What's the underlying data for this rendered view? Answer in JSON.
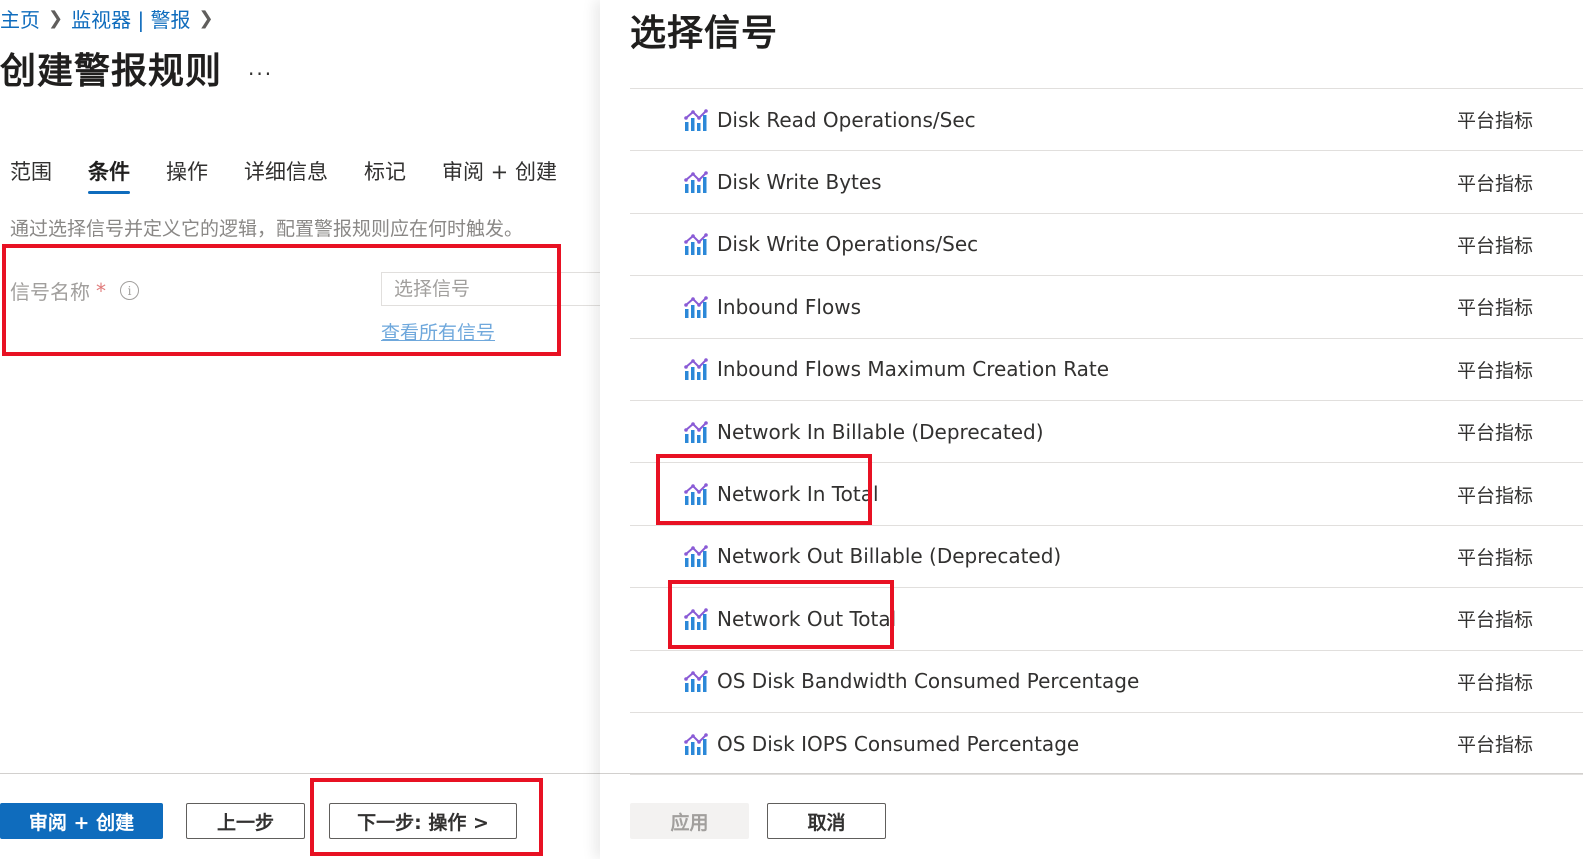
{
  "breadcrumb": {
    "home": "主页",
    "monitor_alerts": "监视器 | 警报"
  },
  "page": {
    "title": "创建警报规则",
    "more": "..."
  },
  "tabs": [
    {
      "label": "范围",
      "active": false
    },
    {
      "label": "条件",
      "active": true
    },
    {
      "label": "操作",
      "active": false
    },
    {
      "label": "详细信息",
      "active": false
    },
    {
      "label": "标记",
      "active": false
    },
    {
      "label": "审阅 + 创建",
      "active": false
    }
  ],
  "condition": {
    "description": "通过选择信号并定义它的逻辑，配置警报规则应在何时触发。",
    "signal_label": "信号名称",
    "required_mark": "*",
    "info": "i",
    "signal_placeholder": "选择信号",
    "view_all_link": "查看所有信号"
  },
  "footer": {
    "review_create": "审阅 + 创建",
    "previous": "上一步",
    "next": "下一步: 操作 >"
  },
  "panel": {
    "title": "选择信号",
    "signals": [
      {
        "name": "Disk Read Operations/Sec",
        "type": "平台指标"
      },
      {
        "name": "Disk Write Bytes",
        "type": "平台指标"
      },
      {
        "name": "Disk Write Operations/Sec",
        "type": "平台指标"
      },
      {
        "name": "Inbound Flows",
        "type": "平台指标"
      },
      {
        "name": "Inbound Flows Maximum Creation Rate",
        "type": "平台指标"
      },
      {
        "name": "Network In Billable (Deprecated)",
        "type": "平台指标"
      },
      {
        "name": "Network In Total",
        "type": "平台指标"
      },
      {
        "name": "Network Out Billable (Deprecated)",
        "type": "平台指标"
      },
      {
        "name": "Network Out Total",
        "type": "平台指标"
      },
      {
        "name": "OS Disk Bandwidth Consumed Percentage",
        "type": "平台指标"
      },
      {
        "name": "OS Disk IOPS Consumed Percentage",
        "type": "平台指标"
      }
    ],
    "apply": "应用",
    "cancel": "取消"
  },
  "colors": {
    "accent": "#0f6cbd",
    "highlight": "#e81123",
    "metric_icon_purple": "#8a5bd6",
    "metric_icon_blue": "#2b88d8"
  }
}
